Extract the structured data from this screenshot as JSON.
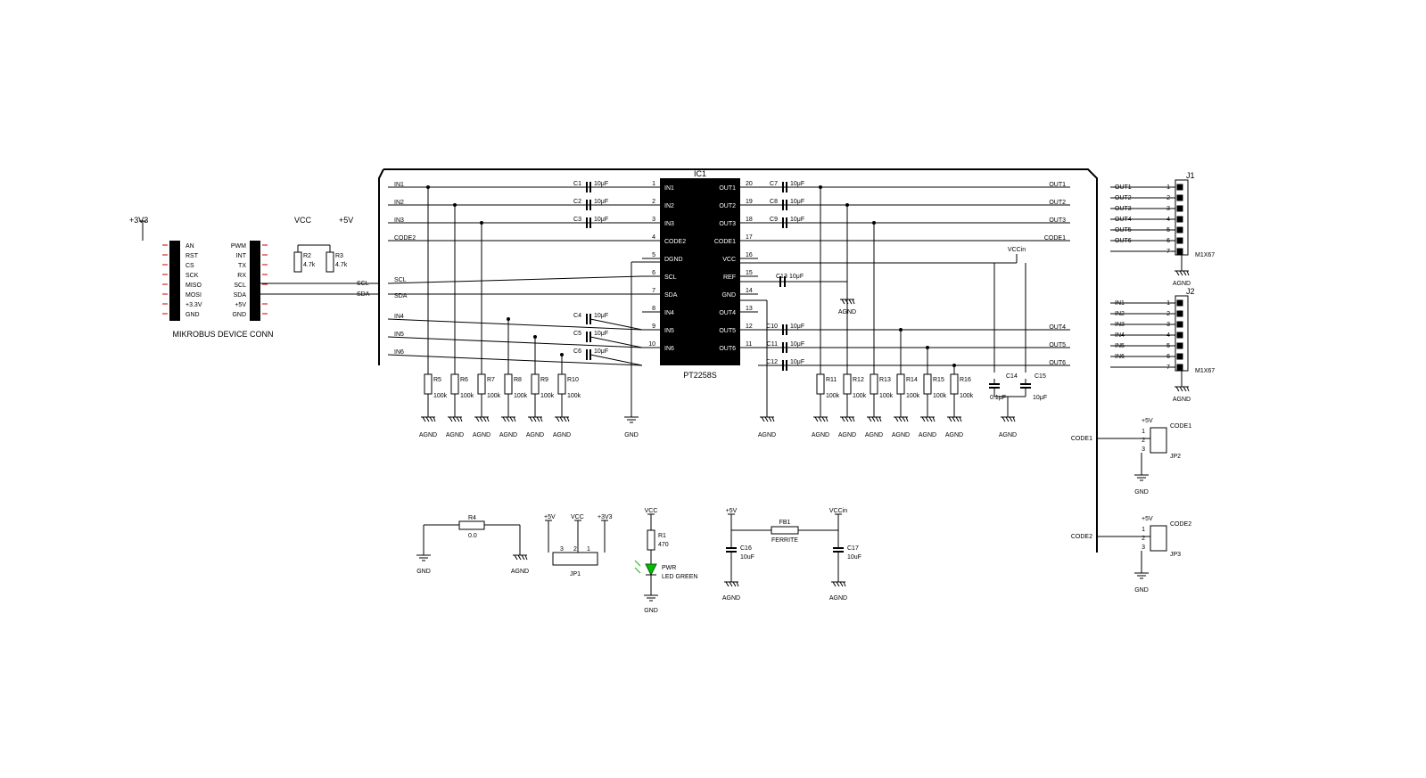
{
  "ic": {
    "ref": "IC1",
    "part": "PT2258S",
    "pins_left": [
      {
        "num": "1",
        "name": "IN1"
      },
      {
        "num": "2",
        "name": "IN2"
      },
      {
        "num": "3",
        "name": "IN3"
      },
      {
        "num": "4",
        "name": "CODE2"
      },
      {
        "num": "5",
        "name": "DGND"
      },
      {
        "num": "6",
        "name": "SCL"
      },
      {
        "num": "7",
        "name": "SDA"
      },
      {
        "num": "8",
        "name": "IN4"
      },
      {
        "num": "9",
        "name": "IN5"
      },
      {
        "num": "10",
        "name": "IN6"
      }
    ],
    "pins_right": [
      {
        "num": "20",
        "name": "OUT1"
      },
      {
        "num": "19",
        "name": "OUT2"
      },
      {
        "num": "18",
        "name": "OUT3"
      },
      {
        "num": "17",
        "name": "CODE1"
      },
      {
        "num": "16",
        "name": "VCC"
      },
      {
        "num": "15",
        "name": "REF"
      },
      {
        "num": "14",
        "name": "GND"
      },
      {
        "num": "13",
        "name": "OUT4"
      },
      {
        "num": "12",
        "name": "OUT5"
      },
      {
        "num": "11",
        "name": "OUT6"
      }
    ]
  },
  "mikrobus": {
    "title": "MIKROBUS DEVICE CONN",
    "left_rail": "+3V3",
    "left_pins": [
      "AN",
      "RST",
      "CS",
      "SCK",
      "MISO",
      "MOSI",
      "+3.3V",
      "GND"
    ],
    "right_rail_vcc": "VCC",
    "right_rail_5v": "+5V",
    "right_pins": [
      "PWM",
      "INT",
      "TX",
      "RX",
      "SCL",
      "SDA",
      "+5V",
      "GND"
    ]
  },
  "pullups": [
    {
      "ref": "R2",
      "val": "4.7k"
    },
    {
      "ref": "R3",
      "val": "4.7k"
    }
  ],
  "input_caps": [
    {
      "ref": "C1",
      "val": "10μF"
    },
    {
      "ref": "C2",
      "val": "10μF"
    },
    {
      "ref": "C3",
      "val": "10μF"
    },
    {
      "ref": "C4",
      "val": "10μF"
    },
    {
      "ref": "C5",
      "val": "10μF"
    },
    {
      "ref": "C6",
      "val": "10μF"
    }
  ],
  "output_caps": [
    {
      "ref": "C7",
      "val": "10μF"
    },
    {
      "ref": "C8",
      "val": "10μF"
    },
    {
      "ref": "C9",
      "val": "10μF"
    },
    {
      "ref": "C10",
      "val": "10μF"
    },
    {
      "ref": "C11",
      "val": "10μF"
    },
    {
      "ref": "C12",
      "val": "10μF"
    }
  ],
  "ref_cap": {
    "ref": "C13",
    "val": "10μF"
  },
  "decouple": [
    {
      "ref": "C14",
      "val": "0.1μF"
    },
    {
      "ref": "C15",
      "val": "10μF"
    }
  ],
  "in_res": [
    {
      "ref": "R5",
      "val": "100k"
    },
    {
      "ref": "R6",
      "val": "100k"
    },
    {
      "ref": "R7",
      "val": "100k"
    },
    {
      "ref": "R8",
      "val": "100k"
    },
    {
      "ref": "R9",
      "val": "100k"
    },
    {
      "ref": "R10",
      "val": "100k"
    }
  ],
  "out_res": [
    {
      "ref": "R11",
      "val": "100k"
    },
    {
      "ref": "R12",
      "val": "100k"
    },
    {
      "ref": "R13",
      "val": "100k"
    },
    {
      "ref": "R14",
      "val": "100k"
    },
    {
      "ref": "R15",
      "val": "100k"
    },
    {
      "ref": "R16",
      "val": "100k"
    }
  ],
  "nets_in": [
    "IN1",
    "IN2",
    "IN3",
    "CODE2",
    "SCL",
    "SDA",
    "IN4",
    "IN5",
    "IN6"
  ],
  "nets_out": [
    "OUT1",
    "OUT2",
    "OUT3",
    "CODE1",
    "VCCin",
    "OUT4",
    "OUT5",
    "OUT6"
  ],
  "j1": {
    "ref": "J1",
    "part": "M1X67",
    "pins": [
      "OUT1",
      "OUT2",
      "OUT3",
      "OUT4",
      "OUT5",
      "OUT6",
      ""
    ],
    "gnd": "AGND"
  },
  "j2": {
    "ref": "J2",
    "part": "M1X67",
    "pins": [
      "IN1",
      "IN2",
      "IN3",
      "IN4",
      "IN5",
      "IN6",
      ""
    ],
    "gnd": "AGND"
  },
  "jp1": {
    "ref": "JP1",
    "rails": [
      "+5V",
      "VCC",
      "+3V3"
    ],
    "pins": [
      "3",
      "2",
      "1"
    ]
  },
  "jp2": {
    "ref": "JP2",
    "rail": "+5V",
    "net": "CODE1",
    "gnd": "GND",
    "pins": [
      "1",
      "2",
      "3"
    ]
  },
  "jp3": {
    "ref": "JP3",
    "rail": "+5V",
    "net": "CODE2",
    "gnd": "GND",
    "pins": [
      "1",
      "2",
      "3"
    ]
  },
  "r4": {
    "ref": "R4",
    "val": "0.0",
    "l": "GND",
    "r": "AGND"
  },
  "led": {
    "r_ref": "R1",
    "r_val": "470",
    "rail": "VCC",
    "name": "PWR",
    "type": "LED GREEN",
    "gnd": "GND"
  },
  "ferrite": {
    "ref": "FB1",
    "val": "FERRITE",
    "l_rail": "+5V",
    "r_rail": "VCCin",
    "c_l": {
      "ref": "C16",
      "val": "10uF"
    },
    "c_r": {
      "ref": "C17",
      "val": "10uF"
    },
    "gnd": "AGND"
  },
  "gnd_labels": {
    "gnd": "GND",
    "agnd": "AGND"
  }
}
